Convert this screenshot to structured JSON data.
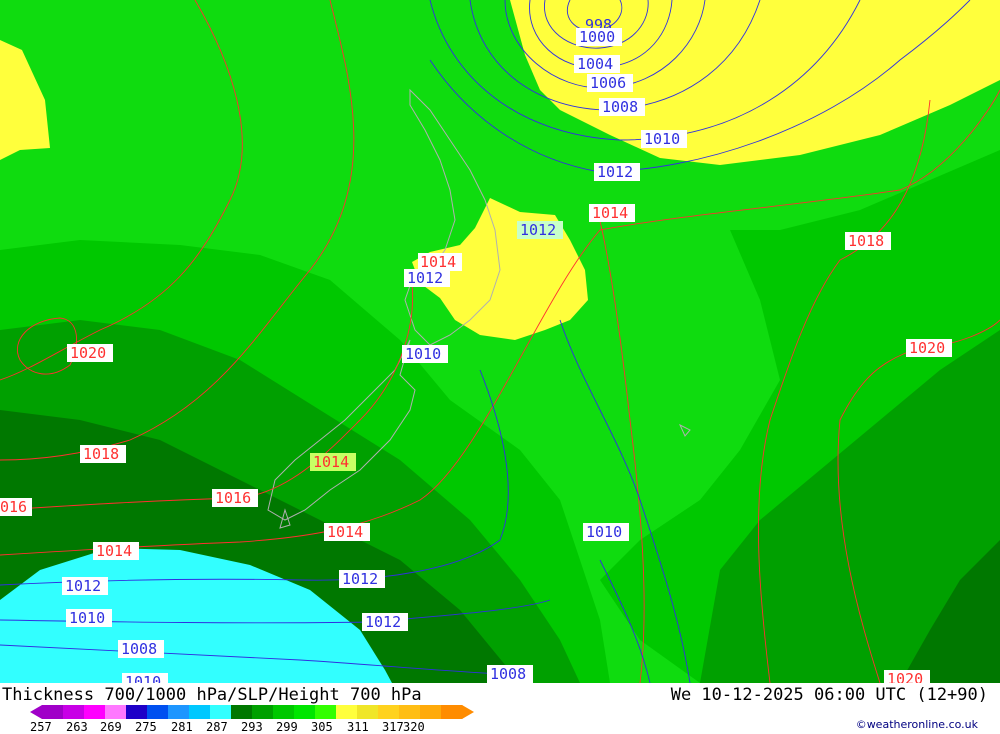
{
  "map": {
    "colors": {
      "c299": "#ffff3c",
      "c293": "#0fdc0f",
      "c292": "#00e600",
      "c290": "#00c800",
      "c287": "#00a000",
      "c284": "#007800",
      "c281": "#32ffff",
      "coast": "#b0b0b0",
      "isobar_high": "#ff3030",
      "isobar_low": "#3030e0"
    },
    "isobar_labels_high": [
      {
        "key": "1014a",
        "text": "1014"
      },
      {
        "key": "1014b",
        "text": "1014"
      },
      {
        "key": "1014c",
        "text": "1014"
      },
      {
        "key": "1014d",
        "text": "1014"
      },
      {
        "key": "1014e",
        "text": "1014"
      },
      {
        "key": "1016a",
        "text": "1016"
      },
      {
        "key": "1016b",
        "text": "016"
      },
      {
        "key": "1018a",
        "text": "1018"
      },
      {
        "key": "1018b",
        "text": "1018"
      },
      {
        "key": "1020a",
        "text": "1020"
      },
      {
        "key": "1020b",
        "text": "1020"
      },
      {
        "key": "1020c",
        "text": "1020"
      }
    ],
    "isobar_labels_low": [
      {
        "key": "998",
        "text": "998"
      },
      {
        "key": "1000",
        "text": "1000"
      },
      {
        "key": "1004",
        "text": "1004"
      },
      {
        "key": "1006",
        "text": "1006"
      },
      {
        "key": "1008a",
        "text": "1008"
      },
      {
        "key": "1008b",
        "text": "1008"
      },
      {
        "key": "1008c",
        "text": "1008"
      },
      {
        "key": "1006b",
        "text": "1006"
      },
      {
        "key": "1010a",
        "text": "1010"
      },
      {
        "key": "1010b",
        "text": "1010"
      },
      {
        "key": "1010c",
        "text": "1010"
      },
      {
        "key": "1010d",
        "text": "1010"
      },
      {
        "key": "1010e",
        "text": "1010"
      },
      {
        "key": "1012a",
        "text": "1012"
      },
      {
        "key": "1012b",
        "text": "1012"
      },
      {
        "key": "1012c",
        "text": "1012"
      },
      {
        "key": "1012d",
        "text": "1012"
      },
      {
        "key": "1012e",
        "text": "1012"
      }
    ]
  },
  "footer": {
    "title": "Thickness 700/1000 hPa/SLP/Height 700 hPa",
    "datetime": "We 10-12-2025 06:00 UTC (12+90)",
    "credit": "©weatheronline.co.uk",
    "scale_ticks": [
      "257",
      "263",
      "269",
      "275",
      "281",
      "287",
      "293",
      "299",
      "305",
      "311",
      "317",
      "320"
    ],
    "scale_colors": [
      "#a000c8",
      "#c800e6",
      "#ff00ff",
      "#ff78ff",
      "#1e00c8",
      "#0050f0",
      "#1e96ff",
      "#00c8ff",
      "#32ffff",
      "#007800",
      "#00a000",
      "#00c800",
      "#00e600",
      "#32ff00",
      "#ffff3c",
      "#f0e628",
      "#ffd21e",
      "#ffbe14",
      "#ffaa0a",
      "#ff8c00"
    ]
  }
}
